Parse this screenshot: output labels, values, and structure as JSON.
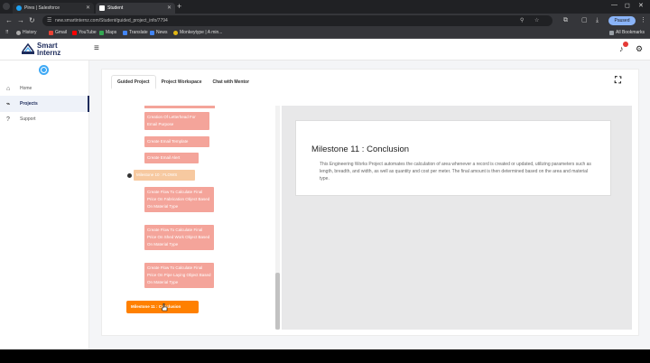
{
  "browser": {
    "tabs": [
      {
        "title": "Pires | Salesforce",
        "favicon_color": "#1ea1f2"
      },
      {
        "title": "Student",
        "favicon_color": "#ffffff"
      }
    ],
    "new_tab": "+",
    "url": "new.smartinternz.com/Student/guided_project_info/7794",
    "profile_label": "Paused",
    "bookmarks": [
      {
        "label": "History",
        "color": "#aaaaaa"
      },
      {
        "label": "Gmail",
        "color": "#ea4335"
      },
      {
        "label": "YouTube",
        "color": "#ff0000"
      },
      {
        "label": "Maps",
        "color": "#34a853"
      },
      {
        "label": "Translate",
        "color": "#4285f4"
      },
      {
        "label": "News",
        "color": "#4285f4"
      },
      {
        "label": "Monkeytype | A min...",
        "color": "#e2b714"
      }
    ],
    "all_bookmarks": "All Bookmarks"
  },
  "app": {
    "logo_line1": "Smart",
    "logo_line2": "Internz",
    "sidebar": [
      {
        "label": "Home",
        "icon": "home-icon",
        "glyph": "⌂",
        "active": false
      },
      {
        "label": "Projects",
        "icon": "projects-icon",
        "glyph": "⌁",
        "active": true
      },
      {
        "label": "Support",
        "icon": "help-icon",
        "glyph": "?",
        "active": false
      }
    ],
    "tabs": [
      "Guided Project",
      "Project Workspace",
      "Chat with Mentor"
    ],
    "milestones": [
      {
        "label": "Creation Of Letterhead For Email Purpose",
        "kind": "task"
      },
      {
        "label": "Create Email Template",
        "kind": "task"
      },
      {
        "label": "Create Email Alert",
        "kind": "task"
      },
      {
        "label": "Milestone 10 : FLOWS",
        "kind": "milestone"
      },
      {
        "label": "Create Flow To Calculate Final Price On Fabrication Object Based On Material Type",
        "kind": "task"
      },
      {
        "label": "Create Flow To Calculate Final Price On Shed Work Object Based On Material Type",
        "kind": "task"
      },
      {
        "label": "Create Flow To Calculate Final Price On Pipe Laying Object Based On Material Type",
        "kind": "task"
      },
      {
        "label": "Milestone 11 : Conclusion",
        "kind": "current"
      }
    ],
    "content": {
      "title": "Milestone 11 : Conclusion",
      "description": "This Engineering Works Project automates the calculation of area whenever a record is created or updated, utilizing parameters such as length, breadth, and width, as well as quantity and cost per meter. The final amount is then determined based on the area and material type."
    }
  },
  "colors": {
    "task": "#f4a49a",
    "milestone": "#f7c9a0",
    "current": "#ff8000",
    "brand": "#1d2b5b"
  }
}
